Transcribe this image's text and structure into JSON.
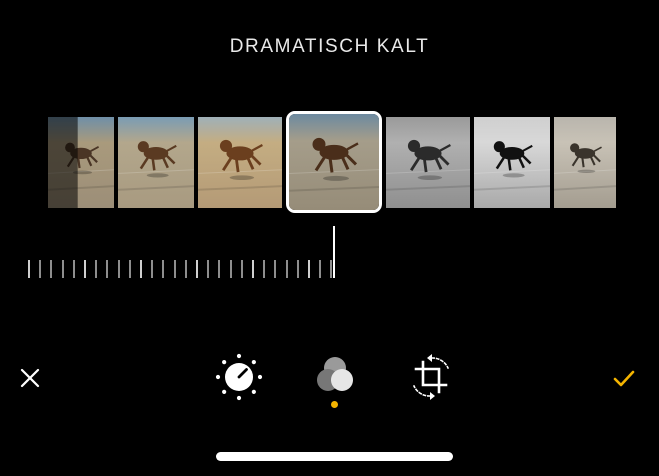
{
  "filter": {
    "title": "DRAMATISCH KALT"
  },
  "filters": [
    {
      "id": "filter-original",
      "tone": "partial-left",
      "selected": false
    },
    {
      "id": "filter-1",
      "tone": "cool-natural",
      "selected": false
    },
    {
      "id": "filter-2",
      "tone": "warm",
      "selected": false
    },
    {
      "id": "filter-3",
      "tone": "warm-strong",
      "selected": false
    },
    {
      "id": "filter-dramatisch-kalt",
      "tone": "dramatic-cool",
      "selected": true
    },
    {
      "id": "filter-5",
      "tone": "mono",
      "selected": false
    },
    {
      "id": "filter-6",
      "tone": "mono-contrast",
      "selected": false
    },
    {
      "id": "filter-7",
      "tone": "silvertone",
      "selected": false
    }
  ],
  "toolbar": {
    "cancel_icon": "close-icon",
    "adjust_icon": "dial-icon",
    "filters_icon": "filters-icon",
    "crop_icon": "crop-rotate-icon",
    "done_icon": "checkmark-icon",
    "active_tab": "filters",
    "accent_color": "#f4b400"
  }
}
